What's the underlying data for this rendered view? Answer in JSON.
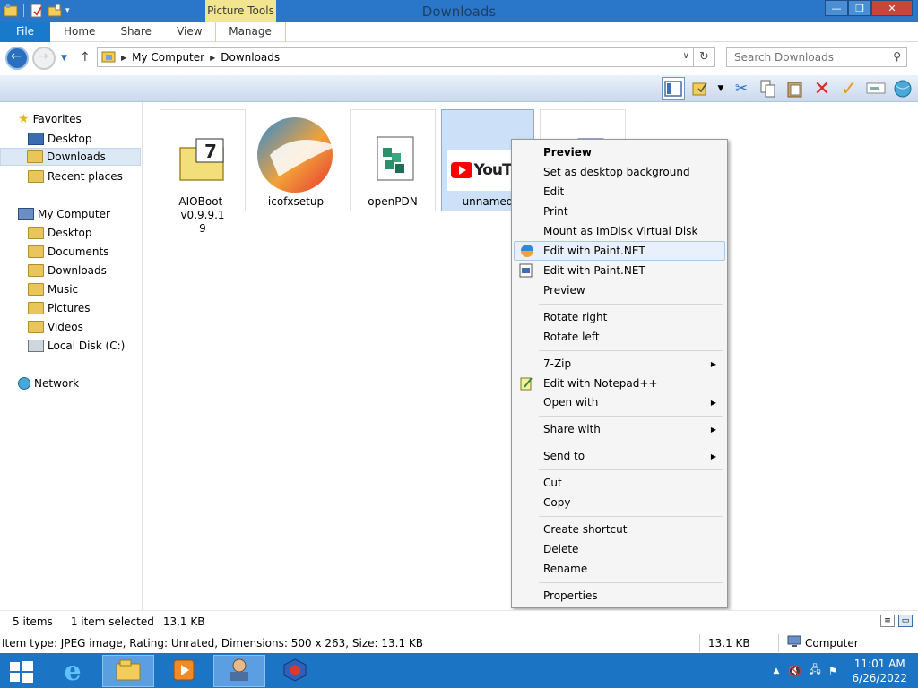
{
  "window": {
    "title": "Downloads",
    "context_tab": "Picture Tools"
  },
  "ribbon": {
    "tabs": [
      "File",
      "Home",
      "Share",
      "View",
      "Manage"
    ]
  },
  "address": {
    "crumbs": [
      "My Computer",
      "Downloads"
    ],
    "search_placeholder": "Search Downloads"
  },
  "navpane": {
    "favorites": "Favorites",
    "fav_items": [
      "Desktop",
      "Downloads",
      "Recent places"
    ],
    "computer": "My Computer",
    "computer_items": [
      "Desktop",
      "Documents",
      "Downloads",
      "Music",
      "Pictures",
      "Videos",
      "Local Disk (C:)"
    ],
    "network": "Network"
  },
  "files": [
    {
      "name": "AIOBoot-v0.9.9.1",
      "name2": "9"
    },
    {
      "name": "icofxsetup",
      "name2": ""
    },
    {
      "name": "openPDN",
      "name2": ""
    },
    {
      "name": "unnamed",
      "name2": ""
    }
  ],
  "thumb_text": "YouTub",
  "context_menu": {
    "items": [
      {
        "label": "Preview"
      },
      {
        "label": "Set as desktop background"
      },
      {
        "label": "Edit"
      },
      {
        "label": "Print"
      },
      {
        "label": "Mount as ImDisk Virtual Disk"
      },
      {
        "label": "Edit with Paint.NET"
      },
      {
        "label": "Edit with Paint.NET"
      },
      {
        "label": "Preview"
      },
      {
        "label": "Rotate right"
      },
      {
        "label": "Rotate left"
      },
      {
        "label": "7-Zip"
      },
      {
        "label": "Edit with Notepad++"
      },
      {
        "label": "Open with"
      },
      {
        "label": "Share with"
      },
      {
        "label": "Send to"
      },
      {
        "label": "Cut"
      },
      {
        "label": "Copy"
      },
      {
        "label": "Create shortcut"
      },
      {
        "label": "Delete"
      },
      {
        "label": "Rename"
      },
      {
        "label": "Properties"
      }
    ]
  },
  "status": {
    "items": "5 items",
    "selected": "1 item selected",
    "size": "13.1 KB"
  },
  "details": {
    "text": "Item type: JPEG image, Rating: Unrated, Dimensions: 500 x 263, Size: 13.1 KB",
    "size": "13.1 KB",
    "location": "Computer"
  },
  "taskbar": {
    "time": "11:01 AM",
    "date": "6/26/2022"
  },
  "colors": {
    "titlebar": "#2a77c9",
    "file_tab": "#1979ca",
    "taskbar": "#1c74c4",
    "context_tab": "#f2e58f",
    "selection": "#cce1f7"
  }
}
